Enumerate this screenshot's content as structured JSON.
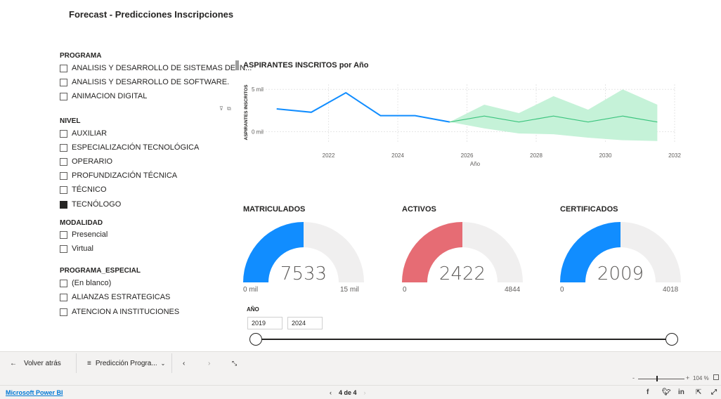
{
  "page_title": "Forecast - Predicciones Inscripciones",
  "slicers": {
    "programa": {
      "title": "PROGRAMA",
      "items": [
        {
          "label": "ANALISIS Y DESARROLLO DE SISTEMAS DE IN...",
          "checked": false
        },
        {
          "label": "ANALISIS Y DESARROLLO DE SOFTWARE.",
          "checked": false
        },
        {
          "label": "ANIMACION DIGITAL",
          "checked": false
        }
      ]
    },
    "nivel": {
      "title": "NIVEL",
      "items": [
        {
          "label": "AUXILIAR",
          "checked": false
        },
        {
          "label": "ESPECIALIZACIÓN TECNOLÓGICA",
          "checked": false
        },
        {
          "label": "OPERARIO",
          "checked": false
        },
        {
          "label": "PROFUNDIZACIÓN TÉCNICA",
          "checked": false
        },
        {
          "label": "TÉCNICO",
          "checked": false
        },
        {
          "label": "TECNÓLOGO",
          "checked": true
        }
      ]
    },
    "modalidad": {
      "title": "MODALIDAD",
      "items": [
        {
          "label": "Presencial",
          "checked": false
        },
        {
          "label": "Virtual",
          "checked": false
        }
      ]
    },
    "programa_especial": {
      "title": "PROGRAMA_ESPECIAL",
      "items": [
        {
          "label": "(En blanco)",
          "checked": false
        },
        {
          "label": "ALIANZAS ESTRATEGICAS",
          "checked": false
        },
        {
          "label": "ATENCION A INSTITUCIONES",
          "checked": false
        }
      ]
    }
  },
  "chart_data": {
    "type": "line",
    "title": "ASPIRANTES INSCRITOS por Año",
    "xlabel": "Año",
    "ylabel": "ASPIRANTES INSCRITOS",
    "xlim": [
      2020.1,
      2032
    ],
    "ylim": [
      -1200,
      5600
    ],
    "x_ticks": [
      2022,
      2024,
      2026,
      2028,
      2030,
      2032
    ],
    "y_ticks": [
      {
        "value": 0,
        "label": "0 mil"
      },
      {
        "value": 5000,
        "label": "5 mil"
      }
    ],
    "grid": true,
    "series": [
      {
        "role": "actual",
        "color": "#118dff",
        "points": [
          [
            2020.5,
            2700
          ],
          [
            2021.5,
            2300
          ],
          [
            2022.5,
            4600
          ],
          [
            2023.5,
            1900
          ],
          [
            2024.5,
            1900
          ],
          [
            2025.5,
            1150
          ]
        ]
      },
      {
        "role": "forecast",
        "color": "#3ac47d",
        "points": [
          [
            2025.5,
            1150
          ],
          [
            2026.5,
            1850
          ],
          [
            2027.5,
            1150
          ],
          [
            2028.5,
            1850
          ],
          [
            2029.5,
            1150
          ],
          [
            2030.5,
            1850
          ],
          [
            2031.5,
            1150
          ]
        ],
        "upper": [
          [
            2025.5,
            1150
          ],
          [
            2026.5,
            3200
          ],
          [
            2027.5,
            2200
          ],
          [
            2028.5,
            4200
          ],
          [
            2029.5,
            2600
          ],
          [
            2030.5,
            5000
          ],
          [
            2031.5,
            3200
          ]
        ],
        "lower": [
          [
            2025.5,
            1150
          ],
          [
            2026.5,
            400
          ],
          [
            2027.5,
            -200
          ],
          [
            2028.5,
            -300
          ],
          [
            2029.5,
            -700
          ],
          [
            2030.5,
            -1000
          ],
          [
            2031.5,
            -1100
          ]
        ],
        "band_color": "#c5f2d8"
      }
    ]
  },
  "kpis": [
    {
      "title": "MATRICULADOS",
      "value": "7533",
      "min_label": "0 mil",
      "max_label": "15 mil",
      "fraction": 0.5,
      "color": "#118dff"
    },
    {
      "title": "ACTIVOS",
      "value": "2422",
      "min_label": "0",
      "max_label": "4844",
      "fraction": 0.5,
      "color": "#e66c74"
    },
    {
      "title": "CERTIFICADOS",
      "value": "2009",
      "min_label": "0",
      "max_label": "4018",
      "fraction": 0.5,
      "color": "#118dff"
    }
  ],
  "year_slicer": {
    "label": "AÑO",
    "from": "2019",
    "to": "2024"
  },
  "bottom_bar": {
    "back_label": "Volver atrás",
    "page_menu_label": "Predicción Progra..."
  },
  "zoom": {
    "value": "104 %"
  },
  "status": {
    "powerbi_label": "Microsoft Power BI",
    "page_indicator": "4 de 4"
  },
  "icons": [
    "back-arrow-icon",
    "menu-lines-icon",
    "chevron-down-icon",
    "prev-page-icon",
    "next-page-icon",
    "fullscreen-icon",
    "filter-icon",
    "focus-icon",
    "facebook-icon",
    "twitter-icon",
    "linkedin-icon",
    "share-icon"
  ],
  "colors": {
    "accent": "#118dff",
    "forecast": "#3ac47d",
    "band": "#c5f2d8",
    "alert": "#e66c74",
    "gauge_bg": "#f0efef"
  }
}
